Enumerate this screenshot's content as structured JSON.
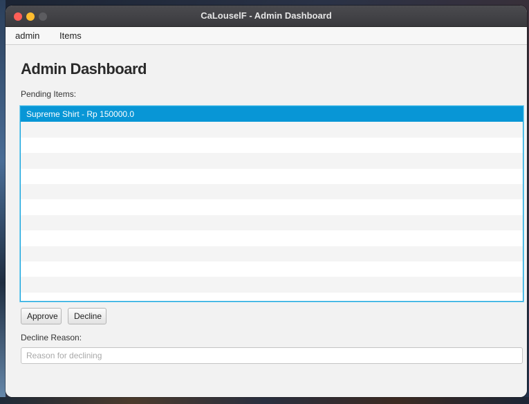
{
  "window": {
    "title": "CaLouselF - Admin Dashboard"
  },
  "menubar": {
    "items": [
      {
        "label": "admin"
      },
      {
        "label": "Items"
      }
    ]
  },
  "page": {
    "heading": "Admin Dashboard",
    "pending_label": "Pending Items:",
    "pending_items": [
      {
        "label": "Supreme Shirt - Rp 150000.0",
        "selected": true
      }
    ],
    "buttons": {
      "approve": "Approve",
      "decline": "Decline"
    },
    "decline_reason_label": "Decline Reason:",
    "decline_reason": {
      "value": "",
      "placeholder": "Reason for declining"
    }
  },
  "colors": {
    "selection": "#0896d6",
    "focus_border": "#1da6dd",
    "close": "#ff5f57",
    "minimize": "#febc2e"
  }
}
